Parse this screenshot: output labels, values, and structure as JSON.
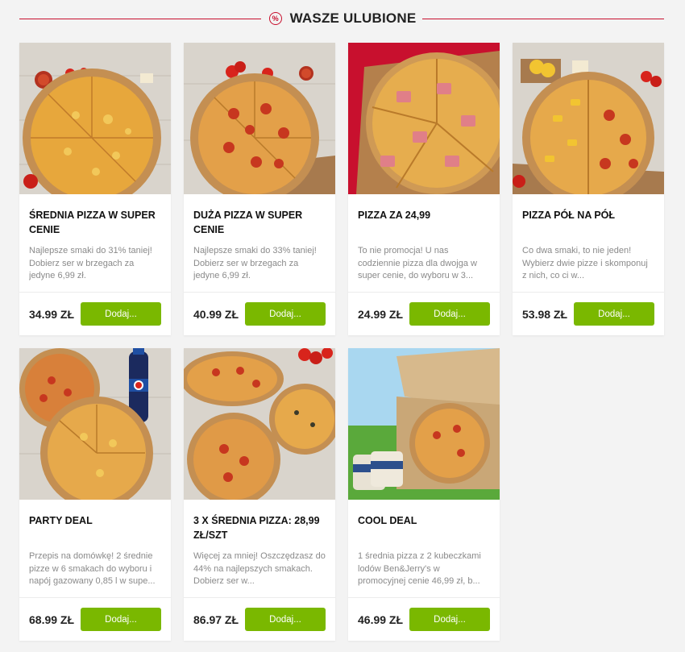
{
  "section": {
    "title": "WASZE ULUBIONE",
    "badge_icon": "percent-badge-icon"
  },
  "colors": {
    "brand_red": "#c8102e",
    "add_green": "#7ab800"
  },
  "products": [
    {
      "name": "ŚREDNIA PIZZA W SUPER CENIE",
      "description": "Najlepsze smaki do 31% taniej! Dobierz ser w brzegach za jedyne 6,99 zł.",
      "price": "34.99 ZŁ",
      "button": "Dodaj..."
    },
    {
      "name": "DUŻA PIZZA W SUPER CENIE",
      "description": "Najlepsze smaki do 33% taniej! Dobierz ser w brzegach za jedyne 6,99 zł.",
      "price": "40.99 ZŁ",
      "button": "Dodaj..."
    },
    {
      "name": "PIZZA ZA 24,99",
      "description": "To nie promocja! U nas codziennie pizza dla dwojga w super cenie, do wyboru w 3...",
      "price": "24.99 ZŁ",
      "button": "Dodaj..."
    },
    {
      "name": "PIZZA PÓŁ NA PÓŁ",
      "description": "Co dwa smaki, to nie jeden! Wybierz dwie pizze i skomponuj z nich, co ci w...",
      "price": "53.98 ZŁ",
      "button": "Dodaj..."
    },
    {
      "name": "PARTY DEAL",
      "description": "Przepis na domówkę! 2 średnie pizze w 6 smakach do wyboru i napój gazowany 0,85 l w supe...",
      "price": "68.99 ZŁ",
      "button": "Dodaj..."
    },
    {
      "name": "3 X ŚREDNIA PIZZA: 28,99 ZŁ/SZT",
      "description": "Więcej za mniej! Oszczędzasz do 44% na najlepszych smakach. Dobierz ser w...",
      "price": "86.97 ZŁ",
      "button": "Dodaj..."
    },
    {
      "name": "COOL DEAL",
      "description": "1 średnia pizza z 2 kubeczkami lodów Ben&Jerry's w promocyjnej cenie 46,99 zł, b...",
      "price": "46.99 ZŁ",
      "button": "Dodaj..."
    }
  ]
}
